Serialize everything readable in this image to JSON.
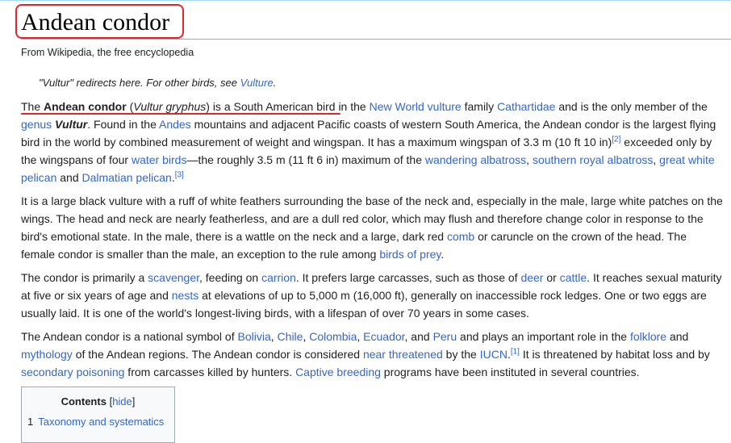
{
  "article": {
    "title": "Andean condor",
    "tagline": "From Wikipedia, the free encyclopedia"
  },
  "hatnote": {
    "text": "\"Vultur\" redirects here. For other birds, see ",
    "link": "Vulture",
    "end": "."
  },
  "p1": {
    "s1": "The ",
    "bold": "Andean condor",
    "s2": " (",
    "italic": "Vultur gryphus",
    "s3": ") is a South American bird in the ",
    "l1": "New World vulture",
    "s4": " family ",
    "l2": "Cathartidae",
    "s5": " and is the only member of the ",
    "l3": "genus",
    "s6": " ",
    "bold_italic": "Vultur",
    "s7": ". Found in the ",
    "l4": "Andes",
    "s8": " mountains and adjacent Pacific coasts of western South America, the Andean condor is the largest flying bird in the world by combined measurement of weight and wingspan. It has a maximum wingspan of 3.3 m (10 ft 10 in)",
    "ref1": "[2]",
    "s9": " exceeded only by the wingspans of four ",
    "l5": "water birds",
    "s10": "—the roughly 3.5 m (11 ft 6 in) maximum of the ",
    "l6": "wandering albatross",
    "s11": ", ",
    "l7": "southern royal albatross",
    "s12": ", ",
    "l8": "great white pelican",
    "s13": " and ",
    "l9": "Dalmatian pelican",
    "s14": ".",
    "ref2": "[3]"
  },
  "p2": {
    "s1": "It is a large black vulture with a ruff of white feathers surrounding the base of the neck and, especially in the male, large white patches on the wings. The head and neck are nearly featherless, and are a dull red color, which may flush and therefore change color in response to the bird's emotional state. In the male, there is a wattle on the neck and a large, dark red ",
    "l1": "comb",
    "s2": " or caruncle on the crown of the head. The female condor is smaller than the male, an exception to the rule among ",
    "l2": "birds of prey",
    "s3": "."
  },
  "p3": {
    "s1": "The condor is primarily a ",
    "l1": "scavenger",
    "s2": ", feeding on ",
    "l2": "carrion",
    "s3": ". It prefers large carcasses, such as those of ",
    "l3": "deer",
    "s4": " or ",
    "l4": "cattle",
    "s5": ". It reaches sexual maturity at five or six years of age and ",
    "l5": "nests",
    "s6": " at elevations of up to 5,000 m (16,000 ft), generally on inaccessible rock ledges. One or two eggs are usually laid. It is one of the world's longest-living birds, with a lifespan of over 70 years in some cases."
  },
  "p4": {
    "s1": "The Andean condor is a national symbol of ",
    "l1": "Bolivia",
    "s2": ", ",
    "l2": "Chile",
    "s3": ", ",
    "l3": "Colombia",
    "s4": ", ",
    "l4": "Ecuador",
    "s5": ", and ",
    "l5": "Peru",
    "s6": " and plays an important role in the ",
    "l6": "folklore",
    "s7": " and ",
    "l7": "mythology",
    "s8": " of the Andean regions. The Andean condor is considered ",
    "l8": "near threatened",
    "s9": " by the ",
    "l9": "IUCN",
    "s10": ".",
    "ref1": "[1]",
    "s11": " It is threatened by habitat loss and by ",
    "l10": "secondary poisoning",
    "s12": " from carcasses killed by hunters. ",
    "l11": "Captive breeding",
    "s13": " programs have been instituted in several countries."
  },
  "toc": {
    "title": "Contents",
    "toggle_open": "[",
    "toggle": "hide",
    "toggle_close": "]",
    "items": [
      {
        "number": "1",
        "label": "Taxonomy and systematics"
      }
    ]
  },
  "colors": {
    "link": "#3366cc",
    "annotation_red": "#e0262b",
    "text": "#202122"
  }
}
